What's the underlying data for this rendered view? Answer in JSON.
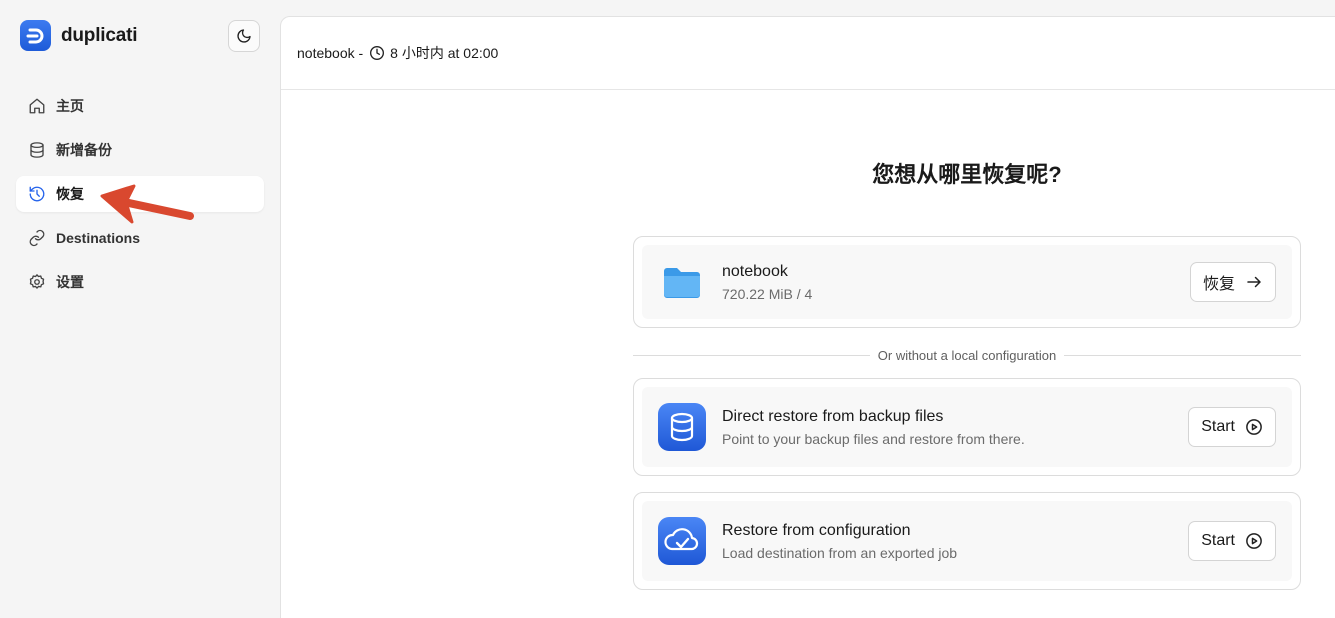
{
  "brand": {
    "name": "duplicati"
  },
  "nav": {
    "items": [
      {
        "label": "主页",
        "icon": "home-icon"
      },
      {
        "label": "新增备份",
        "icon": "database-icon"
      },
      {
        "label": "恢复",
        "icon": "history-icon",
        "active": true
      },
      {
        "label": "Destinations",
        "icon": "link-icon"
      },
      {
        "label": "设置",
        "icon": "gear-icon"
      }
    ]
  },
  "topbar": {
    "backup_name": "notebook -",
    "schedule": "8 小时内 at 02:00"
  },
  "main": {
    "heading": "您想从哪里恢复呢?",
    "backup_card": {
      "title": "notebook",
      "subtitle": "720.22 MiB / 4",
      "button": "恢复"
    },
    "divider_text": "Or without a local configuration",
    "direct_card": {
      "title": "Direct restore from backup files",
      "subtitle": "Point to your backup files and restore from there.",
      "button": "Start"
    },
    "config_card": {
      "title": "Restore from configuration",
      "subtitle": "Load destination from an exported job",
      "button": "Start"
    }
  },
  "colors": {
    "accent": "#2563eb",
    "annotation_arrow": "#d9482f"
  }
}
